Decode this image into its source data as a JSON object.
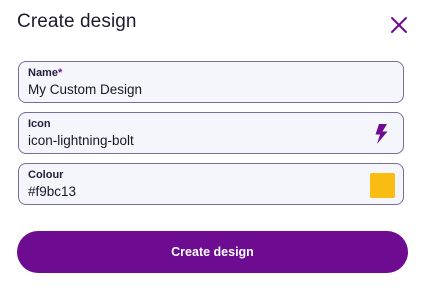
{
  "dialog": {
    "title": "Create design",
    "close_icon": "close-icon"
  },
  "form": {
    "name": {
      "label": "Name",
      "required_mark": "*",
      "value": "My Custom Design"
    },
    "icon": {
      "label": "Icon",
      "value": "icon-lightning-bolt",
      "preview_icon": "lightning-bolt-icon"
    },
    "colour": {
      "label": "Colour",
      "value": "#f9bc13",
      "swatch_color": "#f9bc13"
    }
  },
  "actions": {
    "submit_label": "Create design"
  },
  "theme": {
    "accent": "#6e0c91",
    "field_border": "#7a6c9c",
    "field_bg": "#f4f6fc"
  }
}
